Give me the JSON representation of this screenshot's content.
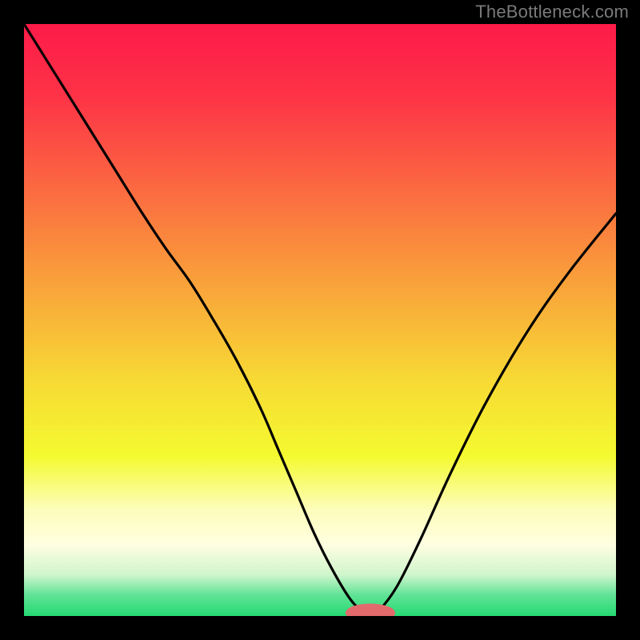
{
  "watermark": "TheBottleneck.com",
  "chart_data": {
    "type": "line",
    "title": "",
    "xlabel": "",
    "ylabel": "",
    "xlim": [
      0,
      100
    ],
    "ylim": [
      0,
      100
    ],
    "grid": false,
    "legend_position": "none",
    "background": {
      "gradient_stops": [
        {
          "offset": 0.0,
          "color": "#fd1b48"
        },
        {
          "offset": 0.12,
          "color": "#fd3247"
        },
        {
          "offset": 0.28,
          "color": "#fb6a41"
        },
        {
          "offset": 0.45,
          "color": "#f9a63a"
        },
        {
          "offset": 0.6,
          "color": "#f7d934"
        },
        {
          "offset": 0.73,
          "color": "#f4fa30"
        },
        {
          "offset": 0.82,
          "color": "#fdfdbb"
        },
        {
          "offset": 0.88,
          "color": "#fefee1"
        },
        {
          "offset": 0.93,
          "color": "#d0f5cd"
        },
        {
          "offset": 0.965,
          "color": "#5fe396"
        },
        {
          "offset": 1.0,
          "color": "#25da72"
        }
      ]
    },
    "series": [
      {
        "name": "bottleneck-curve",
        "color": "#000000",
        "x": [
          0,
          5,
          10,
          15,
          20,
          24,
          28,
          32,
          36,
          40,
          43,
          46,
          49,
          52,
          55,
          57,
          58.5,
          60,
          63,
          67,
          72,
          78,
          85,
          92,
          100
        ],
        "y": [
          100,
          92,
          84,
          76,
          68,
          62,
          56.5,
          50,
          43,
          35,
          28,
          21,
          14,
          8,
          3,
          1,
          0.5,
          1,
          5,
          13,
          24,
          36,
          48,
          58,
          68
        ]
      }
    ],
    "marker": {
      "name": "optimal-range-marker",
      "cx": 58.5,
      "cy": 0.5,
      "rx": 4.2,
      "ry": 1.6,
      "color": "#e26a6c"
    }
  }
}
